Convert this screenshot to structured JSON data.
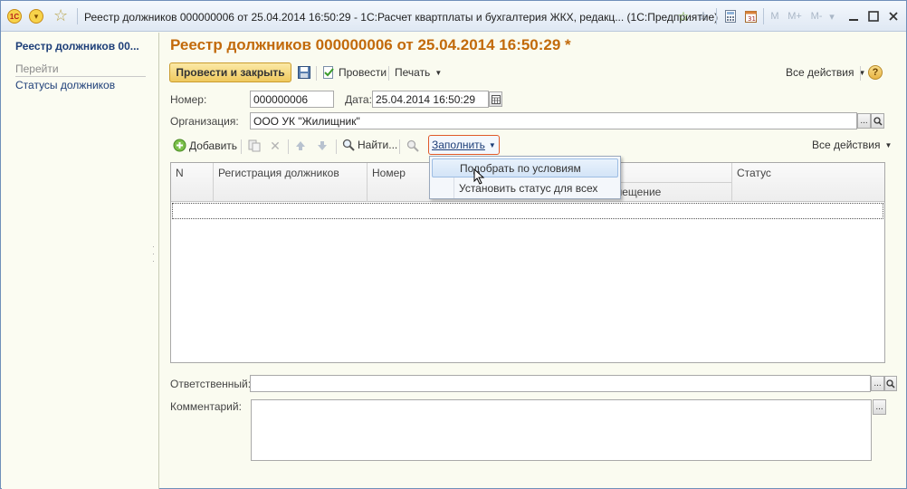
{
  "titlebar": {
    "title": "Реестр должников 000000006 от 25.04.2014 16:50:29 - 1С:Расчет квартплаты и бухгалтерия ЖКХ, редакц...  (1С:Предприятие)",
    "logo": "1С",
    "m_buttons": [
      "M",
      "M+",
      "M-"
    ]
  },
  "sidebar": {
    "title": "Реестр должников 00...",
    "goto_label": "Перейти",
    "links": [
      "Статусы должников"
    ]
  },
  "document": {
    "title": "Реестр должников 000000006 от 25.04.2014 16:50:29 *",
    "toolbar": {
      "post_close": "Провести и закрыть",
      "post": "Провести",
      "print": "Печать",
      "all_actions": "Все действия",
      "help": "?"
    },
    "number_label": "Номер:",
    "number_value": "000000006",
    "date_label": "Дата:",
    "date_value": "25.04.2014 16:50:29",
    "org_label": "Организация:",
    "org_value": "ООО УК \"Жилищник\"",
    "ellipsis": "..."
  },
  "table": {
    "toolbar": {
      "add": "Добавить",
      "find": "Найти...",
      "fill": "Заполнить",
      "all_actions": "Все действия"
    },
    "columns": {
      "n": "N",
      "registration": "Регистрация должников",
      "number": "Номер",
      "premises": "мещение",
      "status": "Статус"
    }
  },
  "fill_menu": {
    "items": [
      "Подобрать по условиям",
      "Установить статус для всех"
    ]
  },
  "footer": {
    "responsible_label": "Ответственный:",
    "responsible_value": "",
    "comment_label": "Комментарий:"
  },
  "colors": {
    "title_orange": "#c26a0b",
    "link_blue": "#1d3e78",
    "primary_button": "#efc95e",
    "highlight_border": "#e05a2a"
  }
}
